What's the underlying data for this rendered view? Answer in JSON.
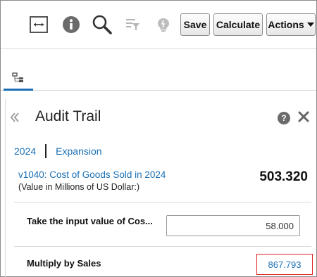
{
  "toolbar": {
    "icons": [
      "expand-width-icon",
      "info-icon",
      "search-icon",
      "filter-icon",
      "bulb-icon"
    ],
    "save_label": "Save",
    "calculate_label": "Calculate",
    "actions_label": "Actions"
  },
  "tabs": [
    {
      "icon": "tree-view-icon",
      "active": true
    }
  ],
  "panel": {
    "title": "Audit Trail",
    "breadcrumb": [
      "2024",
      "Expansion"
    ],
    "member": "v1040: Cost of Goods Sold in 2024",
    "member_unit": "(Value in Millions of US Dollar:)",
    "value": "503.320",
    "rows": [
      {
        "label": "Take the input value of Cos...",
        "value": "58.000"
      },
      {
        "label": "Multiply by Sales",
        "value": "867.793"
      }
    ]
  },
  "colors": {
    "link": "#1a6fb5",
    "highlight": "#e02424",
    "accent": "#1a6fb5"
  }
}
